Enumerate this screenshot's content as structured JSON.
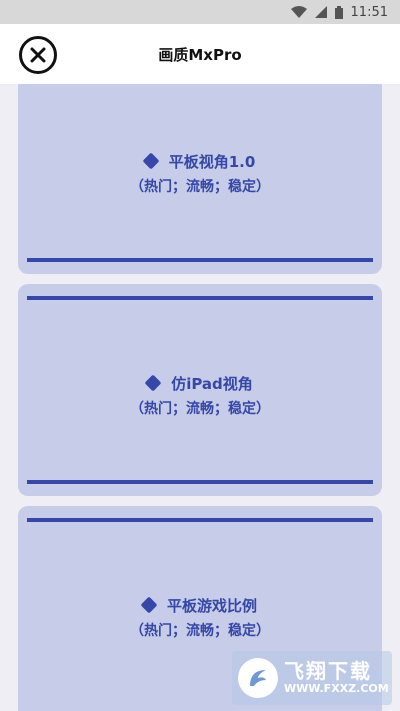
{
  "status_bar": {
    "time": "11:51",
    "icons": [
      "wifi-icon",
      "signal-icon",
      "battery-icon"
    ]
  },
  "header": {
    "title": "画质MxPro",
    "close_icon": "close-icon"
  },
  "cards": [
    {
      "title": "平板视角1.0",
      "subtitle": "（热门；流畅；稳定）"
    },
    {
      "title": "仿iPad视角",
      "subtitle": "（热门；流畅；稳定）"
    },
    {
      "title": "平板游戏比例",
      "subtitle": "（热门；流畅；稳定）"
    }
  ],
  "watermark": {
    "brand": "飞翔下载",
    "url": "WWW.FXXZ.COM"
  },
  "colors": {
    "accent": "#3547a8",
    "card_bg": "#c7cce9",
    "page_bg": "#eeeef4"
  }
}
